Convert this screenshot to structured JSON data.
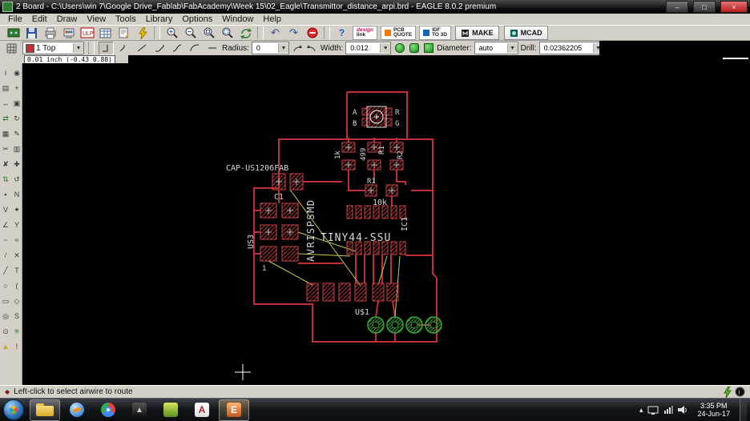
{
  "window": {
    "title": "2 Board - C:\\Users\\win 7\\Google Drive_Fablab\\FabAcademy\\Week 15\\02_Eagle\\Transmittor_distance_arpi.brd - EAGLE 8.0.2 premium",
    "controls": {
      "minimize": "–",
      "maximize": "□",
      "close": "×"
    }
  },
  "menu": {
    "items": [
      "File",
      "Edit",
      "Draw",
      "View",
      "Tools",
      "Library",
      "Options",
      "Window",
      "Help"
    ]
  },
  "toolbar": {
    "design_link_top": "design",
    "design_link_bottom": "link",
    "pcb_quote_top": "PCB",
    "pcb_quote_bottom": "QUOTE",
    "idf_top": "IDF",
    "idf_bottom": "TO 3D",
    "make": "MAKE",
    "mcad": "MCAD",
    "help_glyph": "?"
  },
  "params": {
    "layer": "1 Top",
    "radius_label": "Radius:",
    "radius": "0",
    "width_label": "Width:",
    "width": "0.012",
    "diameter_label": "Diameter:",
    "diameter": "auto",
    "drill_label": "Drill:",
    "drill": "0.02362205"
  },
  "coordinates": "0.01 inch (-0.43 0.88)",
  "status": {
    "bullet": "◆",
    "message": "Left-click to select airwire to route"
  },
  "taskbar": {
    "time": "3:35 PM",
    "date": "24-Jun-17",
    "tray_expand": "▴"
  },
  "palette": {
    "tools": [
      {
        "name": "info",
        "glyph": "i"
      },
      {
        "name": "show",
        "glyph": "◉"
      },
      {
        "name": "display",
        "glyph": "▤"
      },
      {
        "name": "mark",
        "glyph": "+"
      },
      {
        "name": "move",
        "glyph": "↔"
      },
      {
        "name": "copy",
        "glyph": "▣"
      },
      {
        "name": "mirror",
        "glyph": "⇄",
        "color": "#2a7a2a"
      },
      {
        "name": "rotate",
        "glyph": "↻"
      },
      {
        "name": "group",
        "glyph": "▦"
      },
      {
        "name": "change",
        "glyph": "✎"
      },
      {
        "name": "cut",
        "glyph": "✂"
      },
      {
        "name": "paste",
        "glyph": "▥"
      },
      {
        "name": "delete",
        "glyph": "✘"
      },
      {
        "name": "add",
        "glyph": "✚"
      },
      {
        "name": "pinswap",
        "glyph": "⇅",
        "color": "#2a7a2a"
      },
      {
        "name": "replace",
        "glyph": "↺"
      },
      {
        "name": "lock",
        "glyph": "▪"
      },
      {
        "name": "name",
        "glyph": "N"
      },
      {
        "name": "value",
        "glyph": "V"
      },
      {
        "name": "smash",
        "glyph": "✦"
      },
      {
        "name": "miter",
        "glyph": "∠"
      },
      {
        "name": "split",
        "glyph": "Y"
      },
      {
        "name": "optimize",
        "glyph": "~"
      },
      {
        "name": "meander",
        "glyph": "≈"
      },
      {
        "name": "route",
        "glyph": "/",
        "color": "#2a7a2a"
      },
      {
        "name": "ripup",
        "glyph": "✕"
      },
      {
        "name": "wire",
        "glyph": "╱"
      },
      {
        "name": "text",
        "glyph": "T"
      },
      {
        "name": "circle",
        "glyph": "○"
      },
      {
        "name": "arc",
        "glyph": "("
      },
      {
        "name": "rect",
        "glyph": "▭"
      },
      {
        "name": "polygon",
        "glyph": "◇"
      },
      {
        "name": "via",
        "glyph": "◎"
      },
      {
        "name": "signal",
        "glyph": "S"
      },
      {
        "name": "hole",
        "glyph": "⊙"
      },
      {
        "name": "ratsnest",
        "glyph": "✳",
        "color": "#2a7a2a"
      },
      {
        "name": "drc",
        "glyph": "▲",
        "color": "#caa400"
      },
      {
        "name": "errors",
        "glyph": "!",
        "color": "#b00000"
      }
    ]
  },
  "pcb": {
    "labels": [
      {
        "text": "CAP-US1206FAB"
      },
      {
        "text": "C1"
      },
      {
        "text": "US3"
      },
      {
        "text": "AVRISPSMD"
      },
      {
        "text": "1"
      },
      {
        "text": "TINY44-SSU"
      },
      {
        "text": "IC1"
      },
      {
        "text": "1k"
      },
      {
        "text": "499"
      },
      {
        "text": "R1"
      },
      {
        "text": "R2"
      },
      {
        "text": "R1"
      },
      {
        "text": "10k"
      },
      {
        "text": "A"
      },
      {
        "text": "B"
      },
      {
        "text": "R"
      },
      {
        "text": "G"
      },
      {
        "text": "U$1"
      }
    ],
    "colors": {
      "trace": "#c03030",
      "airwire": "#cbcb55",
      "pad_green": "#33aa33"
    }
  }
}
